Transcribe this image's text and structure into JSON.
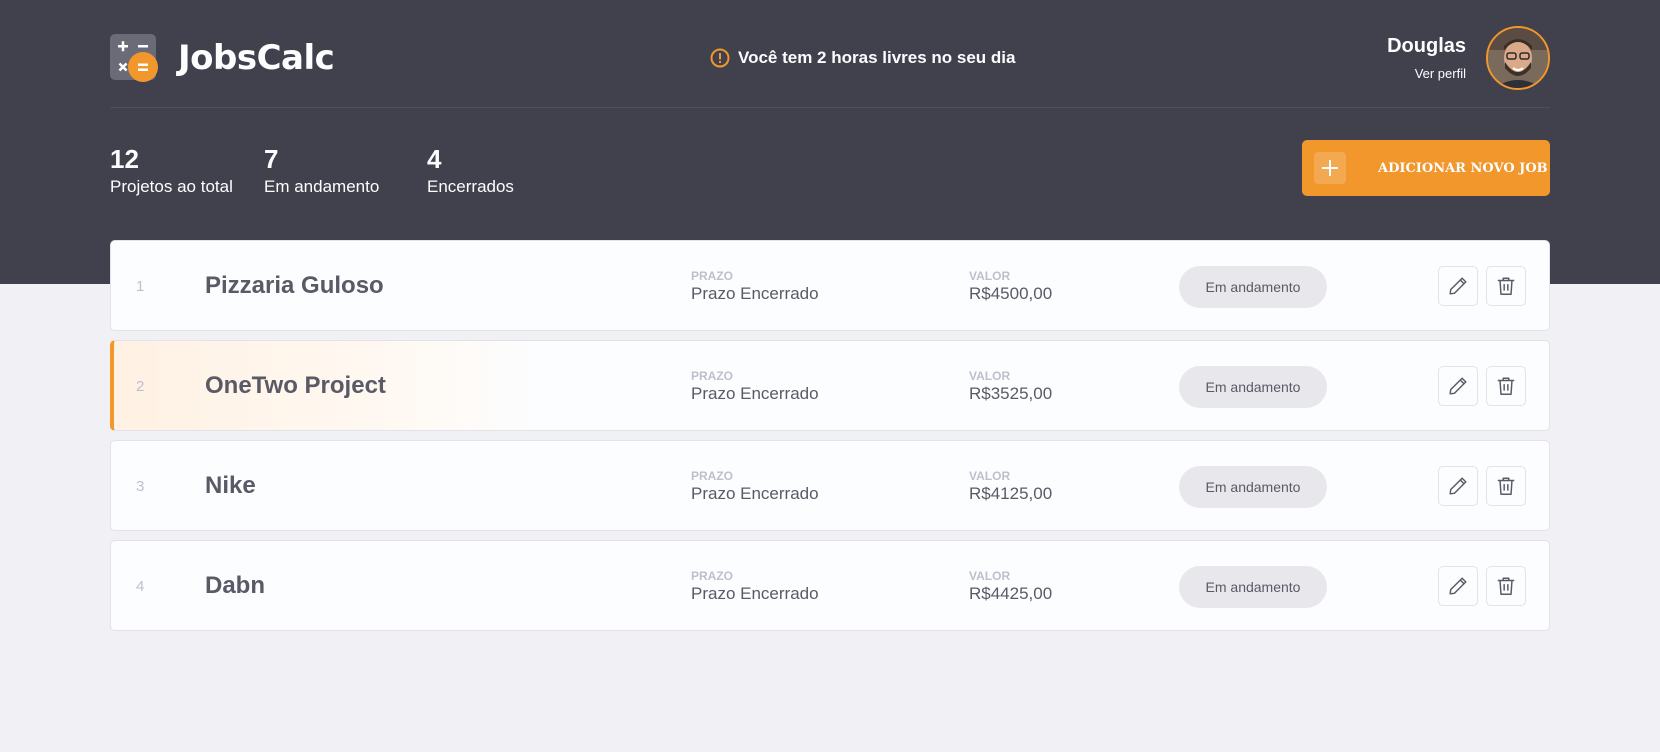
{
  "header": {
    "app_name": "JobsCalc",
    "notice": "Você tem 2 horas livres no seu dia",
    "profile": {
      "name": "Douglas",
      "link": "Ver perfil"
    }
  },
  "summary": {
    "stats": [
      {
        "value": "12",
        "label": "Projetos ao total"
      },
      {
        "value": "7",
        "label": "Em andamento"
      },
      {
        "value": "4",
        "label": "Encerrados"
      }
    ],
    "add_button_label": "ADICIONAR NOVO JOB"
  },
  "jobs": [
    {
      "id": "1",
      "name": "Pizzaria Guloso",
      "deadline_label": "PRAZO",
      "deadline": "Prazo Encerrado",
      "value_label": "VALOR",
      "value": "R$4500,00",
      "status": "Em andamento"
    },
    {
      "id": "2",
      "name": "OneTwo Project",
      "deadline_label": "PRAZO",
      "deadline": "Prazo Encerrado",
      "value_label": "VALOR",
      "value": "R$3525,00",
      "status": "Em andamento"
    },
    {
      "id": "3",
      "name": "Nike",
      "deadline_label": "PRAZO",
      "deadline": "Prazo Encerrado",
      "value_label": "VALOR",
      "value": "R$4125,00",
      "status": "Em andamento"
    },
    {
      "id": "4",
      "name": "Dabn",
      "deadline_label": "PRAZO",
      "deadline": "Prazo Encerrado",
      "value_label": "VALOR",
      "value": "R$4425,00",
      "status": "Em andamento"
    }
  ],
  "icons": {
    "logo": "calculator-logo-icon",
    "notice": "alert-circle-icon",
    "add": "plus-icon",
    "edit": "pencil-icon",
    "delete": "trash-icon"
  },
  "colors": {
    "background_dark": "#41414d",
    "background_light": "#f0f0f5",
    "accent": "#f1972c",
    "card": "#fcfdff"
  }
}
